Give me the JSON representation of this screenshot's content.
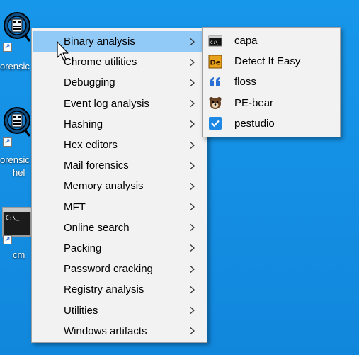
{
  "desktop": {
    "icons": [
      {
        "name": "forensic-tools-icon",
        "label": "orensic"
      },
      {
        "name": "forensic-help-icon",
        "label_line1": "orensic",
        "label_line2": "hel"
      },
      {
        "name": "cmd-icon",
        "label": "cm"
      }
    ]
  },
  "menu": {
    "items": [
      {
        "label": "Binary analysis"
      },
      {
        "label": "Chrome utilities"
      },
      {
        "label": "Debugging"
      },
      {
        "label": "Event log analysis"
      },
      {
        "label": "Hashing"
      },
      {
        "label": "Hex editors"
      },
      {
        "label": "Mail forensics"
      },
      {
        "label": "Memory analysis"
      },
      {
        "label": "MFT"
      },
      {
        "label": "Online search"
      },
      {
        "label": "Packing"
      },
      {
        "label": "Password cracking"
      },
      {
        "label": "Registry analysis"
      },
      {
        "label": "Utilities"
      },
      {
        "label": "Windows artifacts"
      }
    ],
    "active_index": 0
  },
  "submenu": {
    "items": [
      {
        "label": "capa",
        "icon": "console-icon"
      },
      {
        "label": "Detect It Easy",
        "icon": "detect-it-easy-icon"
      },
      {
        "label": "floss",
        "icon": "quote-icon"
      },
      {
        "label": "PE-bear",
        "icon": "bear-icon"
      },
      {
        "label": "pestudio",
        "icon": "checkbox-icon"
      }
    ]
  },
  "colors": {
    "desktop": "#1493e6",
    "menu_bg": "#f2f2f2",
    "highlight": "#91c9f7"
  }
}
